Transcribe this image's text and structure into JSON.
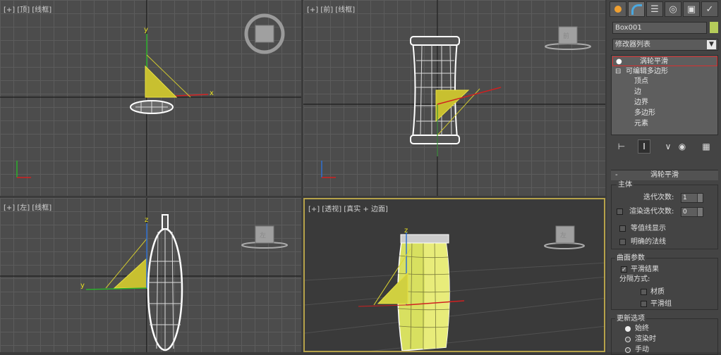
{
  "viewports": {
    "top": {
      "label": "[+] [顶] [线框]",
      "axis_x": "x",
      "axis_y": "y"
    },
    "front": {
      "label": "[+] [前] [线框]",
      "cube": "前"
    },
    "left": {
      "label": "[+] [左] [线框]",
      "axis_y": "y",
      "axis_z": "z",
      "cube": "左"
    },
    "persp": {
      "label": "[+] [透视] [真实 + 边面]",
      "axis_z": "z"
    }
  },
  "panel": {
    "tab_icons": [
      "create-icon",
      "modify-icon",
      "hierarchy-icon",
      "motion-icon",
      "display-icon",
      "utilities-icon"
    ],
    "object_name": "Box001",
    "object_color": "#b5cc5a",
    "modifier_list": "修改器列表",
    "stack": {
      "modifier": "涡轮平滑",
      "base": "可编辑多边形",
      "subobjects": [
        "顶点",
        "边",
        "边界",
        "多边形",
        "元素"
      ]
    },
    "rollout_title": "涡轮平滑",
    "main": {
      "group": "主体",
      "iterations_label": "迭代次数:",
      "iterations_value": "1",
      "render_iters_label": "渲染迭代次数:",
      "render_iters_value": "0",
      "isoline_label": "等值线显示",
      "explicit_normals_label": "明确的法线"
    },
    "surface": {
      "group": "曲面参数",
      "smooth_result": "平滑结果",
      "separate_by": "分隔方式:",
      "materials": "材质",
      "smoothing_groups": "平滑组"
    },
    "update": {
      "group": "更新选项",
      "always": "始终",
      "when_rendering": "渲染时",
      "manually": "手动"
    }
  }
}
